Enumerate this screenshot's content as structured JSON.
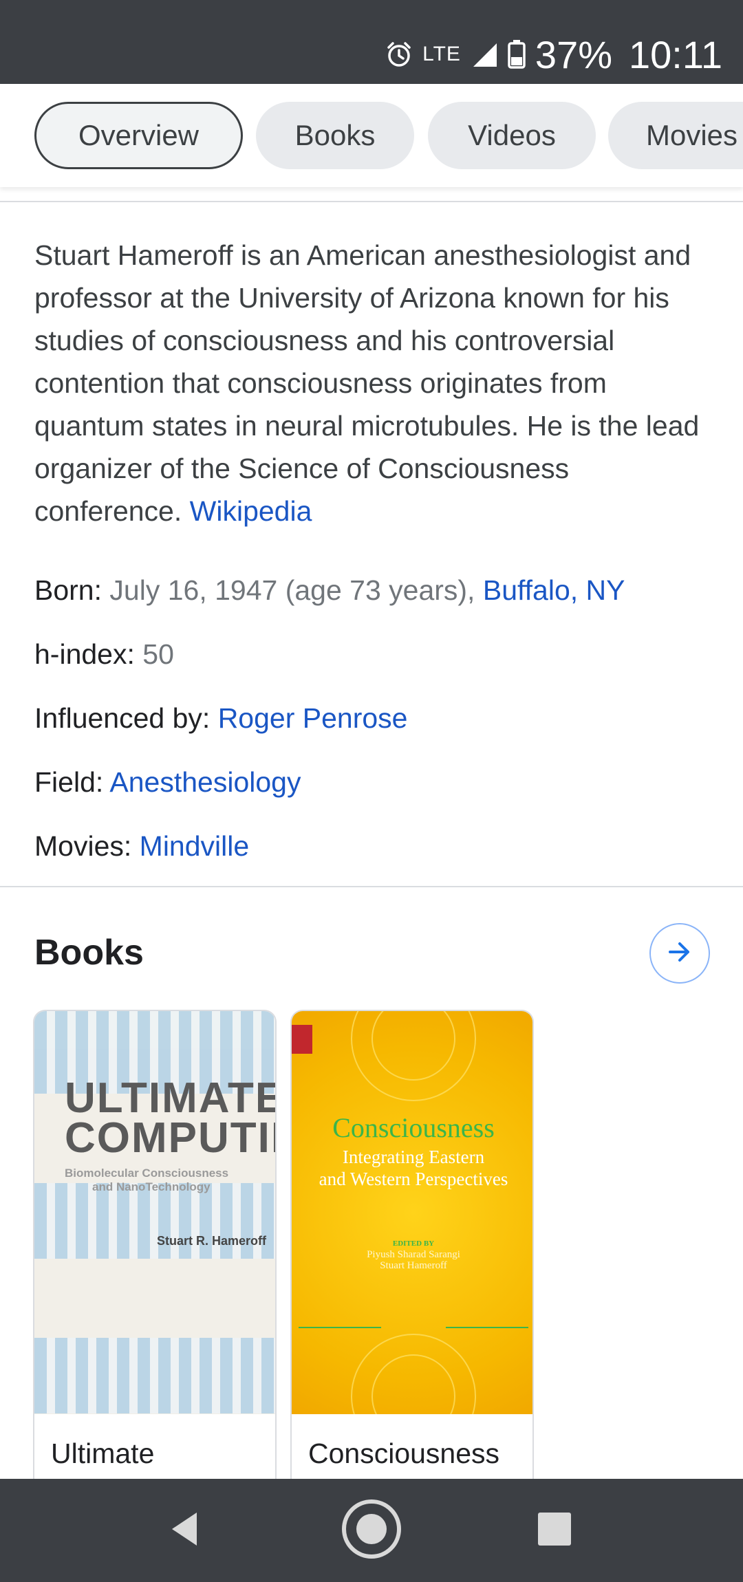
{
  "status_bar": {
    "network": "LTE",
    "battery_percent": "37%",
    "time": "10:11",
    "icons": [
      "alarm-icon",
      "signal-icon",
      "battery-icon"
    ]
  },
  "tabs": [
    {
      "label": "Overview",
      "active": true
    },
    {
      "label": "Books",
      "active": false
    },
    {
      "label": "Videos",
      "active": false
    },
    {
      "label": "Movies",
      "active": false
    }
  ],
  "description": {
    "text": "Stuart Hameroff is an American anesthesiologist and professor at the University of Arizona known for his studies of consciousness and his controversial contention that consciousness originates from quantum states in neural microtubules. He is the lead organizer of the Science of Consciousness conference.",
    "source_link": "Wikipedia"
  },
  "facts": {
    "born": {
      "label": "Born:",
      "value": "July 16, 1947 (age 73 years),",
      "link": "Buffalo, NY"
    },
    "h_index": {
      "label": "h-index:",
      "value": "50"
    },
    "influenced_by": {
      "label": "Influenced by:",
      "link": "Roger Penrose"
    },
    "field": {
      "label": "Field:",
      "link": "Anesthesiology"
    },
    "movies": {
      "label": "Movies:",
      "link": "Mindville"
    }
  },
  "books": {
    "title": "Books",
    "more_icon": "arrow-right-icon",
    "items": [
      {
        "label": "Ultimate",
        "cover": {
          "title_line1": "ULTIMATE",
          "title_line2": "COMPUTING",
          "subtitle_line1": "Biomolecular Consciousness",
          "subtitle_line2": "and NanoTechnology",
          "author": "Stuart R. Hameroff"
        }
      },
      {
        "label": "Consciousness",
        "cover": {
          "title": "Consciousness",
          "subtitle_line1": "Integrating Eastern",
          "subtitle_line2": "and Western Perspectives",
          "editors_label": "EDITED BY",
          "editors_line1": "Piyush Sharad Sarangi",
          "editors_line2": "Stuart Hameroff"
        }
      }
    ]
  },
  "nav_bar": {
    "icons": [
      "back-icon",
      "home-icon",
      "recents-icon"
    ]
  },
  "colors": {
    "status_bar_bg": "#3c3f44",
    "link": "#1a56c4",
    "muted_value": "#70757a",
    "tab_bg": "#e8eaed"
  }
}
